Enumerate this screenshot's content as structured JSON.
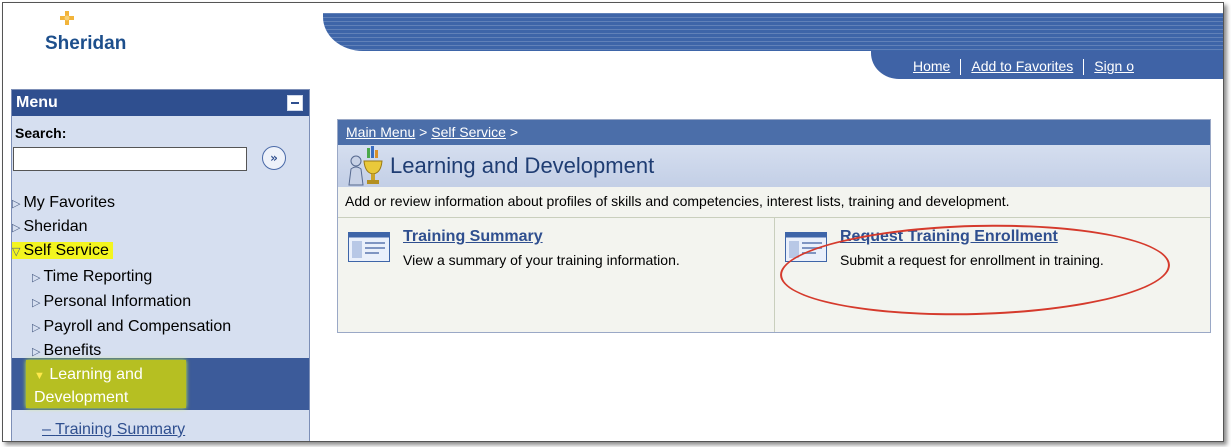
{
  "header": {
    "logo_text": "Sheridan",
    "nav_links": [
      "Home",
      "Add to Favorites",
      "Sign o"
    ]
  },
  "menu": {
    "title": "Menu",
    "search_label": "Search:",
    "search_value": "",
    "items": {
      "my_favorites": "My Favorites",
      "sheridan": "Sheridan",
      "self_service": "Self Service",
      "time_reporting": "Time Reporting",
      "personal_information": "Personal Information",
      "payroll": "Payroll and Compensation",
      "benefits": "Benefits",
      "learning_line1": "Learning and",
      "learning_line2": "Development",
      "training_summary": "Training Summary"
    },
    "colors": {
      "highlight": "#f3f51f",
      "selected_band": "#3c5b9a"
    }
  },
  "content": {
    "breadcrumb": {
      "main_menu": "Main Menu",
      "sep1": " > ",
      "self_service": "Self Service",
      "sep2": " >"
    },
    "title": "Learning and Development",
    "description": "Add or review information about profiles of skills and competencies, interest lists, training and development.",
    "training_summary": {
      "link": "Training Summary",
      "desc": "View a summary of your training information."
    },
    "request_enrollment": {
      "link": "Request Training Enrollment",
      "desc": "Submit a request for enrollment in training."
    },
    "annotation_color": "#d53a2c"
  }
}
